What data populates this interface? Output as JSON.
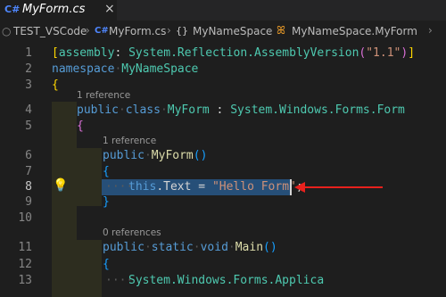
{
  "tab": {
    "lang_icon": "C#",
    "name": "MyForm.cs",
    "close": "×"
  },
  "breadcrumb": {
    "project": "TEST_VSCode",
    "sep": "›",
    "file_icon": "C#",
    "file": "MyForm.cs",
    "ns_icon": "{}",
    "namespace": "MyNameSpace",
    "class_icon": "ꕤ",
    "class": "MyNameSpace.MyForm",
    "more": "›"
  },
  "lines": {
    "n1": "1",
    "n2": "2",
    "n3": "3",
    "n4": "4",
    "n5": "5",
    "n6": "6",
    "n7": "7",
    "n8": "8",
    "n9": "9",
    "n10": "10",
    "n11": "11",
    "n12": "12",
    "n13": "13"
  },
  "code": {
    "l1_a": "[",
    "l1_b": "assembly",
    "l1_c": ": ",
    "l1_d": "System.Reflection.AssemblyVersion",
    "l1_e": "(",
    "l1_f": "\"1.1\"",
    "l1_g": ")",
    "l1_h": "]",
    "l2_kw": "namespace",
    "l2_name": "MyNameSpace",
    "l3": "{",
    "lens4": "1 reference",
    "l4_kw1": "public",
    "l4_kw2": "class",
    "l4_name": "MyForm",
    "l4_colon": " : ",
    "l4_base": "System.Windows.Forms.Form",
    "l5": "{",
    "lens6": "1 reference",
    "l6_kw": "public",
    "l6_name": "MyForm",
    "l6_paren": "()",
    "l7": "{",
    "l8_kw": "this",
    "l8_rest": ".Text = ",
    "l8_str": "\"Hello Form\"",
    "l8_semi": ";",
    "l9": "}",
    "lens11": "0 references",
    "l11_kw1": "public",
    "l11_kw2": "static",
    "l11_kw3": "void",
    "l11_name": "Main",
    "l11_paren": "()",
    "l12": "{",
    "l13_text": "System.Windows.Forms.Applica"
  },
  "annotation": {
    "arrow_color": "#e8211d"
  },
  "colors": {
    "keyword": "#569cd6",
    "type": "#4ec9b0",
    "function": "#dcdcaa",
    "string": "#ce9178",
    "selection": "#264f78"
  }
}
